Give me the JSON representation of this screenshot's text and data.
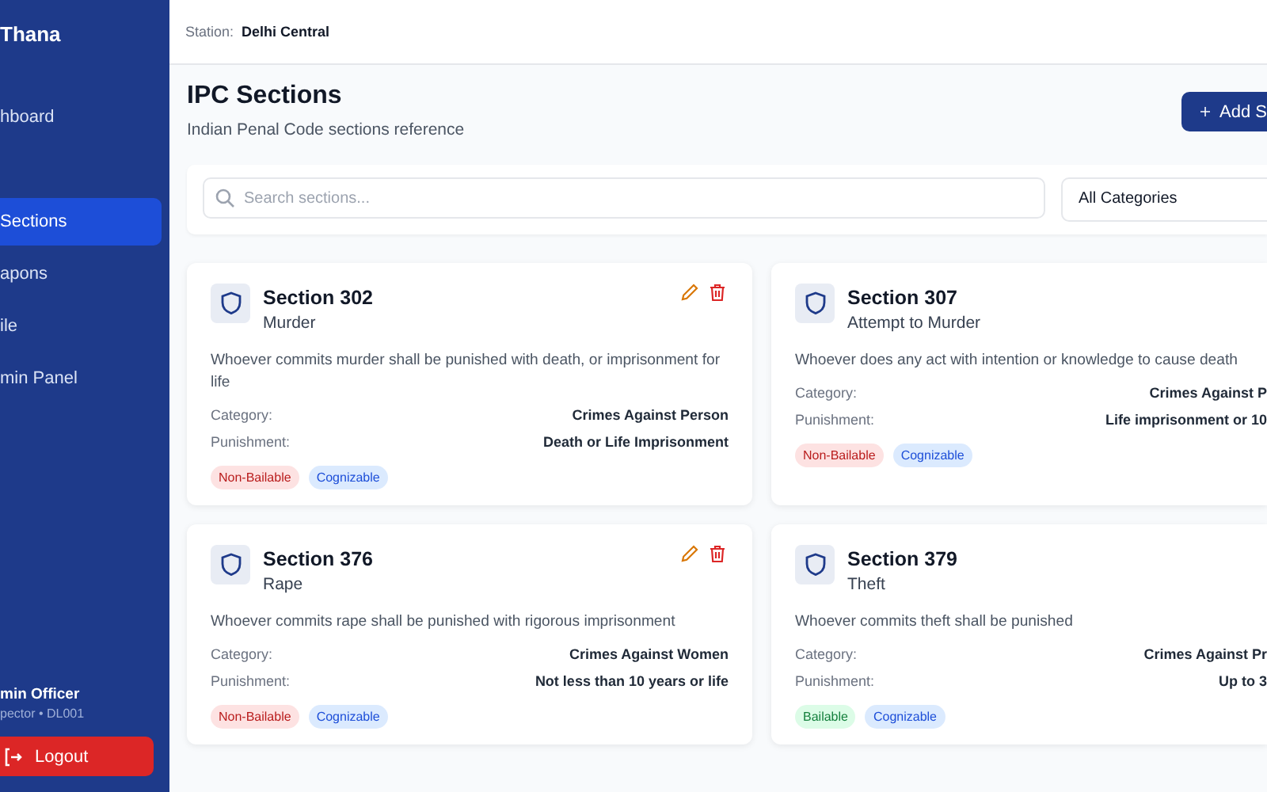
{
  "sidebar": {
    "brand": "Thana",
    "items": [
      {
        "label": "hboard",
        "selected": false
      },
      {
        "label": "Sections",
        "selected": true
      },
      {
        "label": "apons",
        "selected": false
      },
      {
        "label": "ile",
        "selected": false
      },
      {
        "label": "min Panel",
        "selected": false
      }
    ],
    "user": {
      "name": "min Officer",
      "role": "pector • DL001"
    },
    "logout": "Logout"
  },
  "header": {
    "station_label": "Station:",
    "station": "Delhi Central"
  },
  "page": {
    "title": "IPC Sections",
    "subtitle": "Indian Penal Code sections reference",
    "add_button": "Add S"
  },
  "filters": {
    "search_placeholder": "Search sections...",
    "category": "All Categories"
  },
  "cards": [
    {
      "section": "Section 302",
      "name": "Murder",
      "description": "Whoever commits murder shall be punished with death, or imprisonment for life",
      "category_label": "Category:",
      "category": "Crimes Against Person",
      "punishment_label": "Punishment:",
      "punishment": "Death or Life Imprisonment",
      "tags": [
        {
          "label": "Non-Bailable",
          "kind": "non-bailable"
        },
        {
          "label": "Cognizable",
          "kind": "cognizable"
        }
      ],
      "actions_visible": true
    },
    {
      "section": "Section 307",
      "name": "Attempt to Murder",
      "description": "Whoever does any act with intention or knowledge to cause death",
      "category_label": "Category:",
      "category": "Crimes Against P",
      "punishment_label": "Punishment:",
      "punishment": "Life imprisonment or 10",
      "tags": [
        {
          "label": "Non-Bailable",
          "kind": "non-bailable"
        },
        {
          "label": "Cognizable",
          "kind": "cognizable"
        }
      ],
      "actions_visible": false
    },
    {
      "section": "Section 376",
      "name": "Rape",
      "description": "Whoever commits rape shall be punished with rigorous imprisonment",
      "category_label": "Category:",
      "category": "Crimes Against Women",
      "punishment_label": "Punishment:",
      "punishment": "Not less than 10 years or life",
      "tags": [
        {
          "label": "Non-Bailable",
          "kind": "non-bailable"
        },
        {
          "label": "Cognizable",
          "kind": "cognizable"
        }
      ],
      "actions_visible": true
    },
    {
      "section": "Section 379",
      "name": "Theft",
      "description": "Whoever commits theft shall be punished",
      "category_label": "Category:",
      "category": "Crimes Against Pr",
      "punishment_label": "Punishment:",
      "punishment": "Up to 3",
      "tags": [
        {
          "label": "Bailable",
          "kind": "bailable"
        },
        {
          "label": "Cognizable",
          "kind": "cognizable"
        }
      ],
      "actions_visible": false
    }
  ]
}
